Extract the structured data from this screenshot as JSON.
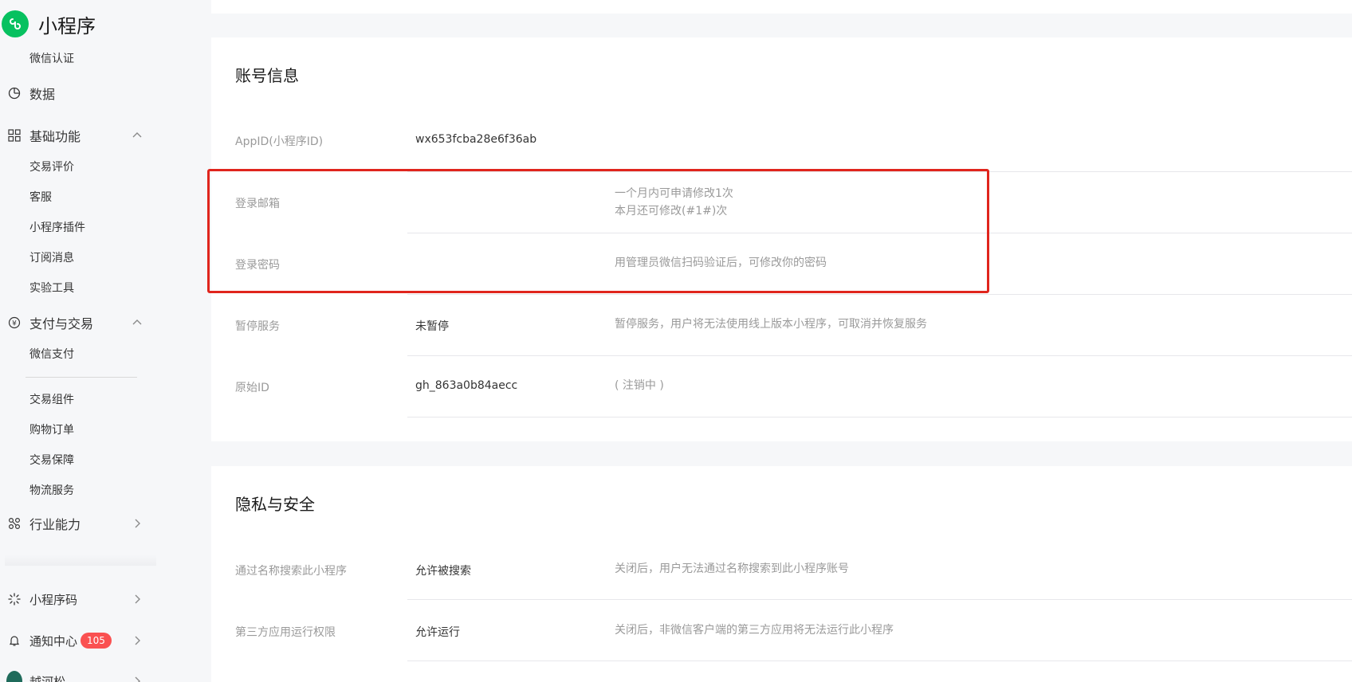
{
  "brand": {
    "title": "小程序"
  },
  "sidebar": {
    "top_sub": "微信认证",
    "data_label": "数据",
    "basic": {
      "label": "基础功能",
      "items": [
        "交易评价",
        "客服",
        "小程序插件",
        "订阅消息",
        "实验工具"
      ]
    },
    "pay": {
      "label": "支付与交易",
      "items": [
        "微信支付",
        "交易组件",
        "购物订单",
        "交易保障",
        "物流服务"
      ]
    },
    "industry_label": "行业能力",
    "qrcode_label": "小程序码",
    "notify": {
      "label": "通知中心",
      "badge": "105"
    },
    "account_label": "越河松"
  },
  "account": {
    "title": "账号信息",
    "rows": [
      {
        "label": "AppID(小程序ID)",
        "value": "wx653fcba28e6f36ab",
        "note": ""
      },
      {
        "label": "登录邮箱",
        "value": "",
        "note1": "一个月内可申请修改1次",
        "note2": "本月还可修改(#1#)次"
      },
      {
        "label": "登录密码",
        "value": "",
        "note": "用管理员微信扫码验证后，可修改你的密码"
      },
      {
        "label": "暂停服务",
        "value": "未暂停",
        "note": "暂停服务，用户将无法使用线上版本小程序，可取消并恢复服务"
      },
      {
        "label": "原始ID",
        "value": "gh_863a0b84aecc",
        "note": "( 注销中 )"
      }
    ]
  },
  "privacy": {
    "title": "隐私与安全",
    "rows": [
      {
        "label": "通过名称搜索此小程序",
        "value": "允许被搜索",
        "note": "关闭后，用户无法通过名称搜索到此小程序账号"
      },
      {
        "label": "第三方应用运行权限",
        "value": "允许运行",
        "note": "关闭后，非微信客户端的第三方应用将无法运行此小程序"
      }
    ]
  },
  "colors": {
    "brand": "#07c160",
    "highlight": "#e0251d",
    "badge": "#fa5151"
  },
  "icons": [
    "miniprogram-logo-icon",
    "pie-chart-icon",
    "grid-icon",
    "yuan-icon",
    "molecule-icon",
    "sparkle-icon",
    "bell-icon",
    "chevron-up-icon",
    "chevron-right-icon"
  ]
}
